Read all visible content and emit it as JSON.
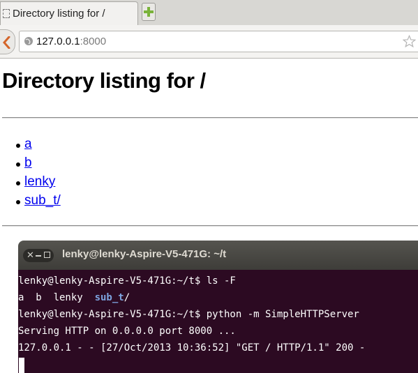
{
  "browser": {
    "tab_title": "Directory listing for /",
    "url_host": "127.0.0.1",
    "url_port": ":8000"
  },
  "page": {
    "title": "Directory listing for /",
    "files": [
      "a",
      "b",
      "lenky",
      "sub_t/"
    ]
  },
  "terminal": {
    "title": "lenky@lenky-Aspire-V5-471G: ~/t",
    "lines": {
      "line1": "lenky@lenky-Aspire-V5-471G:~/t$ ls -F",
      "line2_files": "a  b  lenky  ",
      "line2_dir": "sub_t",
      "line2_slash": "/",
      "line3": "lenky@lenky-Aspire-V5-471G:~/t$ python -m SimpleHTTPServer",
      "line4": "Serving HTTP on 0.0.0.0 port 8000 ...",
      "line5": "127.0.0.1 - - [27/Oct/2013 10:36:52] \"GET / HTTP/1.1\" 200 -"
    }
  },
  "colors": {
    "link": "#0000ee",
    "terminal_bg": "#2c0a22",
    "terminal_dir": "#7da3df",
    "newtab_plus": "#7ab33a"
  },
  "icons": {
    "tab": "page-icon",
    "new_tab": "plus-icon",
    "back": "back-arrow-icon",
    "site": "globe-icon",
    "bookmark": "star-icon"
  }
}
